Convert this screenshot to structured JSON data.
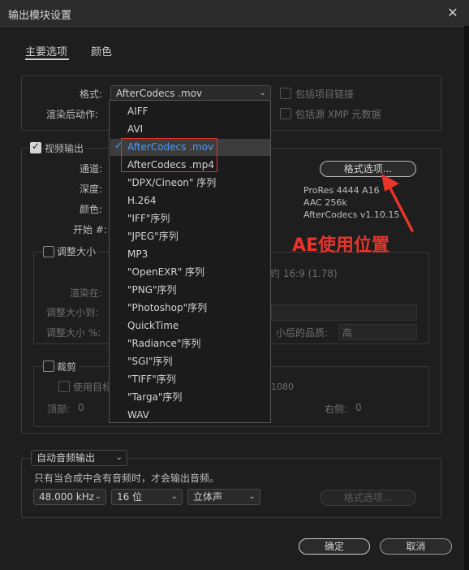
{
  "window": {
    "title": "输出模块设置",
    "close_glyph": "✕"
  },
  "tabs": [
    {
      "label": "主要选项"
    },
    {
      "label": "颜色"
    }
  ],
  "format": {
    "label": "格式:",
    "value": "AfterCodecs .mov",
    "include_project_link": "包括项目链接",
    "post_render_label": "渲染后动作:",
    "include_xmp": "包括源 XMP 元数据"
  },
  "video": {
    "checkbox_label": "视频输出",
    "channels_label": "通道:",
    "depth_label": "深度:",
    "color_label": "颜色:",
    "start_label": "开始 #:",
    "format_options_button": "格式选项...",
    "info_lines": [
      "ProRes 4444 A16",
      "AAC 256k",
      "AfterCodecs v1.10.15"
    ]
  },
  "resize": {
    "checkbox_label": "调整大小",
    "aspect_text": "约 16:9 (1.78)",
    "render_at_label": "渲染在:",
    "resize_to_label": "调整大小到:",
    "resize_pct_label": "调整大小 %:",
    "quality_label": "小后的品质:",
    "quality_value": "高"
  },
  "crop": {
    "checkbox_label": "裁剪",
    "use_roi_label": "使用目标",
    "size_text": "1080",
    "top_label": "顶部:",
    "top_value": "0",
    "right_label": "右侧:",
    "right_value": "0"
  },
  "format_menu": {
    "items": [
      "AIFF",
      "AVI",
      "AfterCodecs .mov",
      "AfterCodecs .mp4",
      "\"DPX/Cineon\" 序列",
      "H.264",
      "\"IFF\"序列",
      "\"JPEG\"序列",
      "MP3",
      "\"OpenEXR\" 序列",
      "\"PNG\"序列",
      "\"Photoshop\"序列",
      "QuickTime",
      "\"Radiance\"序列",
      "\"SGI\"序列",
      "\"TIFF\"序列",
      "\"Targa\"序列",
      "WAV"
    ],
    "selected_index": 2,
    "check_glyph": "✓"
  },
  "annotation": {
    "text": "AE使用位置",
    "color": "#e8342a"
  },
  "audio": {
    "mode": "自动音频输出",
    "note": "只有当合成中含有音频时，才会输出音频。",
    "sample_rate": "48.000 kHz",
    "bit_depth": "16 位",
    "channels": "立体声",
    "format_options_button": "格式选项..."
  },
  "footer": {
    "ok": "确定",
    "cancel": "取消"
  },
  "colors": {
    "accent_blue": "#4a9cff",
    "annotation_red": "#e8342a"
  }
}
